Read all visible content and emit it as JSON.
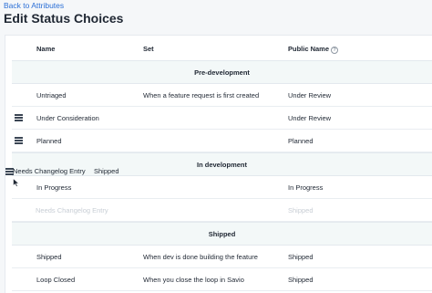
{
  "nav": {
    "back_label": "Back to Attributes"
  },
  "page": {
    "title": "Edit Status Choices"
  },
  "columns": {
    "name": "Name",
    "set": "Set",
    "public_name": "Public Name",
    "public_name_icon": "help-circle-icon"
  },
  "groups": [
    {
      "label": "Pre-development",
      "rows": [
        {
          "name": "Untriaged",
          "set": "When a feature request is first created",
          "public_name": "Under Review",
          "draggable": false
        },
        {
          "name": "Under Consideration",
          "set": "",
          "public_name": "Under Review",
          "draggable": true
        },
        {
          "name": "Planned",
          "set": "",
          "public_name": "Planned",
          "draggable": true
        }
      ]
    },
    {
      "label": "In development",
      "rows": [
        {
          "name": "In Progress",
          "set": "",
          "public_name": "In Progress",
          "draggable": false
        },
        {
          "name": "Needs Changelog Entry",
          "set": "",
          "public_name": "Shipped",
          "draggable": true,
          "state": "dragging-placeholder"
        }
      ]
    },
    {
      "label": "Shipped",
      "rows": [
        {
          "name": "Shipped",
          "set": "When dev is done building the feature",
          "public_name": "Shipped",
          "draggable": false
        },
        {
          "name": "Loop Closed",
          "set": "When you close the loop in Savio",
          "public_name": "Shipped",
          "draggable": false
        }
      ]
    }
  ],
  "drag_ghost": {
    "name": "Needs Changelog Entry",
    "public_name": "Shipped",
    "icon": "drag-handle-icon"
  },
  "cursor": {
    "icon": "move-cursor-icon"
  },
  "colors": {
    "link": "#2b6fd6",
    "group_bg": "#f3f8f8",
    "page_bg": "#f5f7f9",
    "faded_text": "#c8ced5"
  }
}
